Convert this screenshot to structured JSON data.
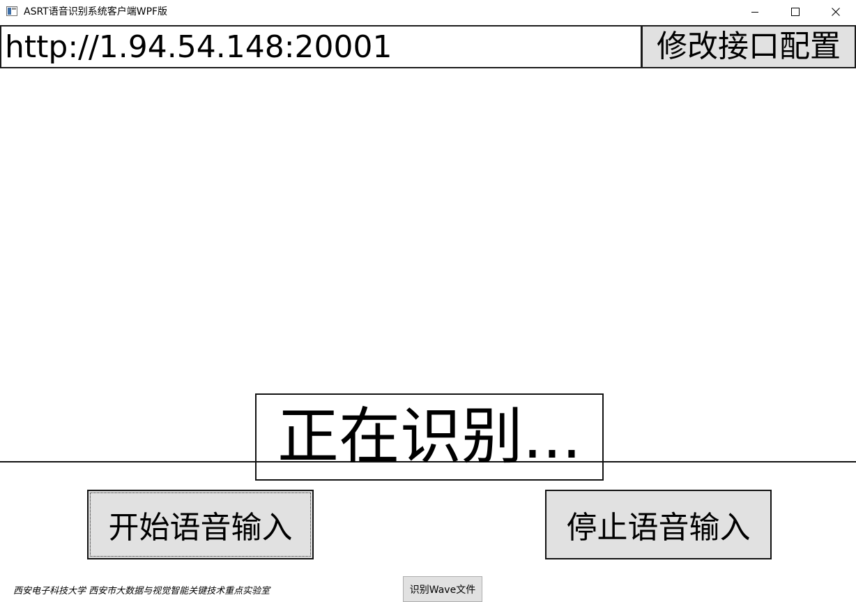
{
  "window": {
    "title": "ASRT语音识别系统客户端WPF版",
    "icons": {
      "app": "app-window-icon",
      "minimize": "minimize-icon",
      "maximize": "maximize-icon",
      "close": "close-icon"
    }
  },
  "server": {
    "url_value": "http://1.94.54.148:20001",
    "config_button_label": "修改接口配置"
  },
  "status": {
    "text": "正在识别..."
  },
  "controls": {
    "start_label": "开始语音输入",
    "stop_label": "停止语音输入",
    "wave_label": "识别Wave文件"
  },
  "footer": {
    "credits": "西安电子科技大学  西安市大数据与视觉智能关键技术重点实验室"
  },
  "colors": {
    "button_face": "#e1e1e1",
    "border": "#1a1a1a",
    "background": "#ffffff"
  }
}
